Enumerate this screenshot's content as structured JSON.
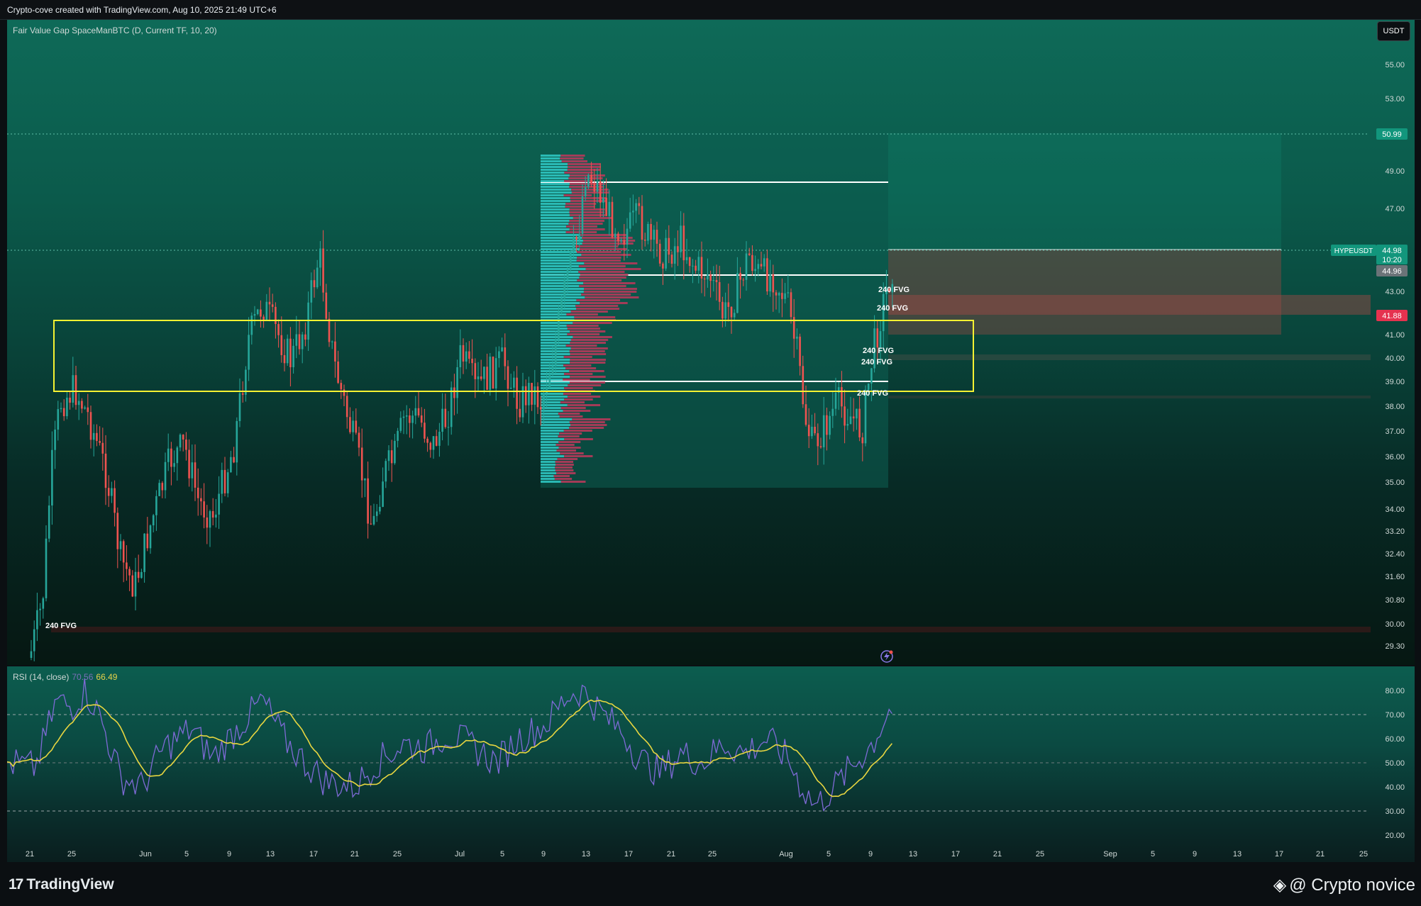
{
  "header": {
    "created_text": "Crypto-cove created with TradingView.com, Aug 10, 2025 21:49 UTC+6"
  },
  "price_pane": {
    "indicator_title": "Fair Value Gap SpaceManBTC (D, Current TF, 10, 20)",
    "currency_label": "USDT",
    "y_axis_labels": [
      "55.00",
      "53.00",
      "49.00",
      "47.00",
      "43.00",
      "41.00",
      "40.00",
      "39.00",
      "38.00",
      "37.00",
      "36.00",
      "35.00",
      "34.00",
      "33.20",
      "32.40",
      "31.60",
      "30.80",
      "30.00",
      "29.30"
    ],
    "price_tags": {
      "top_level": "50.99",
      "symbol": "HYPEUSDT",
      "last_price": "44.98",
      "countdown": "10:20",
      "high_tag": "44.96",
      "red_level": "41.88"
    },
    "fvg_label": "240 FVG",
    "colors": {
      "up": "#26a69a",
      "down": "#ef5350",
      "highlight_box": "#f5f232",
      "red_tag": "#e5324f",
      "green_tag": "#12967c"
    }
  },
  "rsi_pane": {
    "title": "RSI (14, close)",
    "rsi_value": "70.56",
    "ma_value": "66.49",
    "y_axis_labels": [
      "80.00",
      "70.00",
      "60.00",
      "50.00",
      "40.00",
      "30.00",
      "20.00"
    ],
    "levels": [
      70,
      50,
      30
    ],
    "colors": {
      "rsi": "#7e6ad6",
      "ma": "#e8d640"
    }
  },
  "x_axis": {
    "labels": [
      "21",
      "25",
      "Jun",
      "5",
      "9",
      "13",
      "17",
      "21",
      "25",
      "Jul",
      "5",
      "9",
      "13",
      "17",
      "21",
      "25",
      "Aug",
      "5",
      "9",
      "13",
      "17",
      "21",
      "25",
      "Sep",
      "5",
      "9",
      "13",
      "17",
      "21",
      "25"
    ]
  },
  "footer": {
    "brand": "TradingView",
    "credit": "@ Crypto novice"
  },
  "chart_data": [
    {
      "type": "candlestick",
      "symbol": "HYPEUSDT",
      "timeframe": "D",
      "ylim": [
        28.8,
        56.5
      ],
      "last_price": 44.98,
      "levels": {
        "range_box_top": 41.7,
        "range_box_bottom": 38.7,
        "fvg_zone_top": 43.0,
        "fvg_zone_bottom": 41.88,
        "projection_top": 50.99
      }
    },
    {
      "type": "line",
      "title": "RSI (14, close)",
      "ylim": [
        20,
        85
      ],
      "series": [
        {
          "name": "RSI",
          "last": 70.56
        },
        {
          "name": "MA",
          "last": 66.49
        }
      ]
    }
  ]
}
